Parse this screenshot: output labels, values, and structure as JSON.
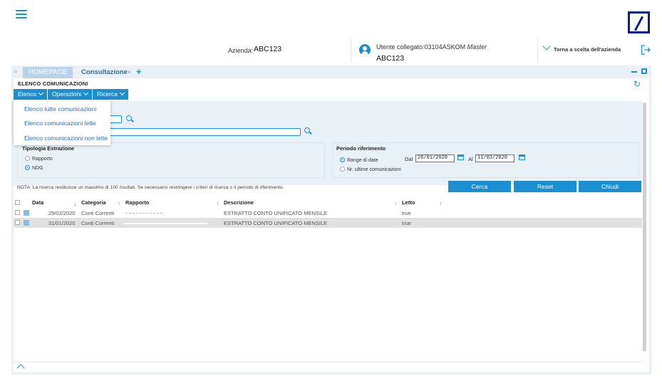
{
  "header": {
    "azienda_label": "Azienda:",
    "azienda_value": "ABC123",
    "utente_label": "Utente collegato:03104ASKOM",
    "utente_role": "Master",
    "utente_value": "ABC123",
    "back_label": "Torna a scelta dell'azienda"
  },
  "tabs": {
    "home": "HOMEPAGE",
    "current": "Consultazione",
    "close": "×",
    "add": "+"
  },
  "page": {
    "title": "ELENCO COMUNICAZIONI",
    "refresh_icon": "refresh-icon"
  },
  "menu": {
    "elenco": "Elenco",
    "operazioni": "Operazioni",
    "ricerca": "Ricerca"
  },
  "dropdown": {
    "items": [
      "Elenco tutte comunicazioni",
      "Elenco comunicazioni lette",
      "Elenco comunicazioni non lette"
    ]
  },
  "tipologia": {
    "title": "Tipologia Estrazione",
    "options": [
      "Rapporto",
      "NDG"
    ],
    "selected": "NDG"
  },
  "periodo": {
    "title": "Periodo riferimento",
    "option_range": "Range di date",
    "option_ultime": "Nr. ultime comunicazioni",
    "selected": "Range di date",
    "dal_label": "Dal",
    "dal_value": "26/01/2020",
    "al_label": "Al",
    "al_value": "11/03/2020"
  },
  "nota": "NOTA: La ricerca restituisce un massimo di 100 risultati. Se necessario restringere i criteri di ricerca o il periodo di riferimento.",
  "buttons": {
    "cerca": "Cerca",
    "reset": "Reset",
    "chiudi": "Chiudi"
  },
  "table": {
    "headers": {
      "data": "Data",
      "categoria": "Categoria",
      "rapporto": "Rapporto",
      "descrizione": "Descrizione",
      "letto": "Letto"
    },
    "rows": [
      {
        "data": "29/02/2020",
        "categoria": "Conti Correnti",
        "descrizione": "ESTRATTO CONTO UNIFICATO MENSILE",
        "letto": "true"
      },
      {
        "data": "31/01/2020",
        "categoria": "Conti Correnti",
        "descrizione": "ESTRATTO CONTO UNIFICATO MENSILE",
        "letto": "true"
      }
    ]
  },
  "colors": {
    "accent": "#1a8fd1",
    "panel": "#e9f1f7",
    "logo": "#0a1f8f"
  }
}
